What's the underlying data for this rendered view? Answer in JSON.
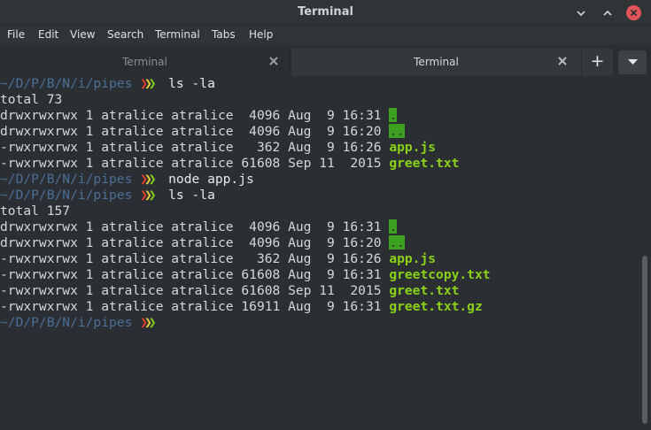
{
  "window": {
    "title": "Terminal"
  },
  "menu": [
    "File",
    "Edit",
    "View",
    "Search",
    "Terminal",
    "Tabs",
    "Help"
  ],
  "tabs": [
    {
      "label": "Terminal",
      "active": false
    },
    {
      "label": "Terminal",
      "active": true
    }
  ],
  "add_tab_label": "+",
  "colors": {
    "accent_close": "#e0545a",
    "path": "#4a6f96",
    "file_green": "#8ad118",
    "chev_red": "#e33d2d",
    "chev_yellow": "#e8d13a",
    "chev_green": "#84d01c"
  },
  "prompt_path": "~/D/P/B/N/i/pipes",
  "terminal": {
    "cmd1": "ls -la",
    "total1": "total 73",
    "rows1": [
      {
        "perm": "drwxrwxrwx 1 atralice atralice  4096 Aug  9 16:31 ",
        "name": ".",
        "dir": true
      },
      {
        "perm": "drwxrwxrwx 1 atralice atralice  4096 Aug  9 16:20 ",
        "name": "..",
        "dir": true
      },
      {
        "perm": "-rwxrwxrwx 1 atralice atralice   362 Aug  9 16:26 ",
        "name": "app.js",
        "dir": false
      },
      {
        "perm": "-rwxrwxrwx 1 atralice atralice 61608 Sep 11  2015 ",
        "name": "greet.txt",
        "dir": false
      }
    ],
    "cmd2": "node app.js",
    "cmd3": "ls -la",
    "total2": "total 157",
    "rows2": [
      {
        "perm": "drwxrwxrwx 1 atralice atralice  4096 Aug  9 16:31 ",
        "name": ".",
        "dir": true
      },
      {
        "perm": "drwxrwxrwx 1 atralice atralice  4096 Aug  9 16:20 ",
        "name": "..",
        "dir": true
      },
      {
        "perm": "-rwxrwxrwx 1 atralice atralice   362 Aug  9 16:26 ",
        "name": "app.js",
        "dir": false
      },
      {
        "perm": "-rwxrwxrwx 1 atralice atralice 61608 Aug  9 16:31 ",
        "name": "greetcopy.txt",
        "dir": false
      },
      {
        "perm": "-rwxrwxrwx 1 atralice atralice 61608 Sep 11  2015 ",
        "name": "greet.txt",
        "dir": false
      },
      {
        "perm": "-rwxrwxrwx 1 atralice atralice 16911 Aug  9 16:31 ",
        "name": "greet.txt.gz",
        "dir": false
      }
    ]
  }
}
